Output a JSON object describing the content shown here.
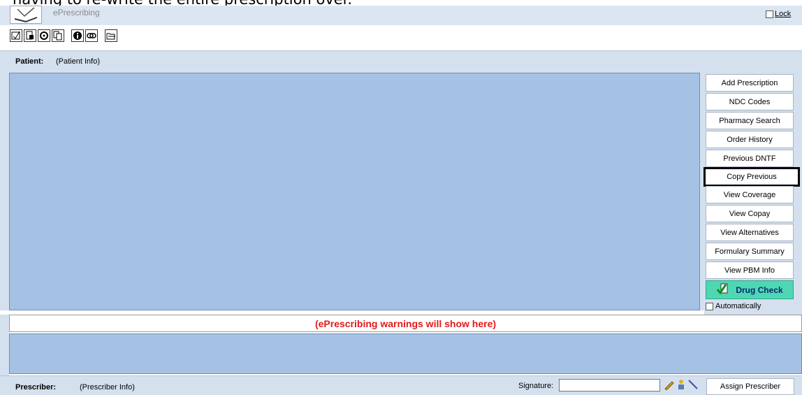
{
  "caption": "having to re-write the entire prescription over.",
  "app": {
    "title": "ePrescribing",
    "lock_label": "Lock"
  },
  "toolbar": {
    "icons": [
      "notepad-check-icon",
      "page-hand-icon",
      "rx-gear-icon",
      "copy-pages-icon",
      "info-icon",
      "link-icon",
      "open-folder-icon"
    ]
  },
  "patient": {
    "label": "Patient:",
    "info": "(Patient Info)"
  },
  "side_buttons": [
    "Add Prescription",
    "NDC Codes",
    "Pharmacy Search",
    "Order History",
    "Previous DNTF",
    "Copy Previous",
    "View Coverage",
    "View Copay",
    "View Alternatives",
    "Formulary Summary",
    "View PBM Info"
  ],
  "drug_check": {
    "label": "Drug Check",
    "auto_label": "Automatically"
  },
  "warnings": {
    "text": "(ePrescribing warnings will show here)"
  },
  "prescriber": {
    "label": "Prescriber:",
    "info": "(Prescriber Info)",
    "signature_label": "Signature:",
    "signature_value": "",
    "assign_label": "Assign Prescriber"
  },
  "colors": {
    "panel": "#a5c2e5",
    "frame": "#d4e0ee",
    "warning_text": "#e21b1b",
    "drug_check_bg": "#4fd7b4",
    "active_border": "#000000"
  }
}
